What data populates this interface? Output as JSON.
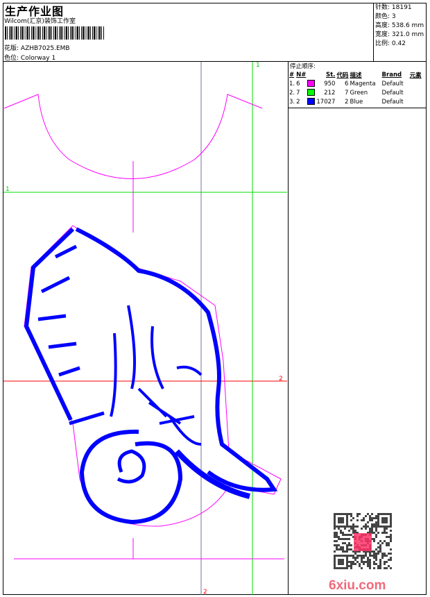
{
  "header": {
    "title": "生产作业图",
    "company": "Wilcom(汇京)装饰工作室",
    "design_label": "花版:",
    "design_value": "AZHB7025.EMB",
    "colorway_label": "色位:",
    "colorway_value": "Colorway 1"
  },
  "info": [
    {
      "label": "针数:",
      "value": "18191"
    },
    {
      "label": "颜色:",
      "value": "3"
    },
    {
      "label": "高度:",
      "value": "538.6 mm"
    },
    {
      "label": "宽度:",
      "value": "321.0 mm"
    },
    {
      "label": "比例:",
      "value": "0.42"
    }
  ],
  "stops": {
    "title": "停止顺序:",
    "columns": [
      "#",
      "N#",
      "",
      "St.",
      "代码",
      "描述",
      "Brand",
      "元素"
    ],
    "rows": [
      {
        "idx": "1.",
        "n": "6",
        "color": "#ff00ff",
        "st": "950",
        "code": "6",
        "desc": "Magenta",
        "brand": "Default"
      },
      {
        "idx": "2.",
        "n": "7",
        "color": "#00ff00",
        "st": "212",
        "code": "7",
        "desc": "Green",
        "brand": "Default"
      },
      {
        "idx": "3.",
        "n": "2",
        "color": "#0000ff",
        "st": "17027",
        "code": "2",
        "desc": "Blue",
        "brand": "Default"
      }
    ]
  },
  "markers": {
    "green_top": "1",
    "green_left": "1",
    "red_right": "2",
    "red_bottom": "2"
  },
  "watermark": {
    "site": "6xiu.com",
    "seal": "以图搜版"
  }
}
